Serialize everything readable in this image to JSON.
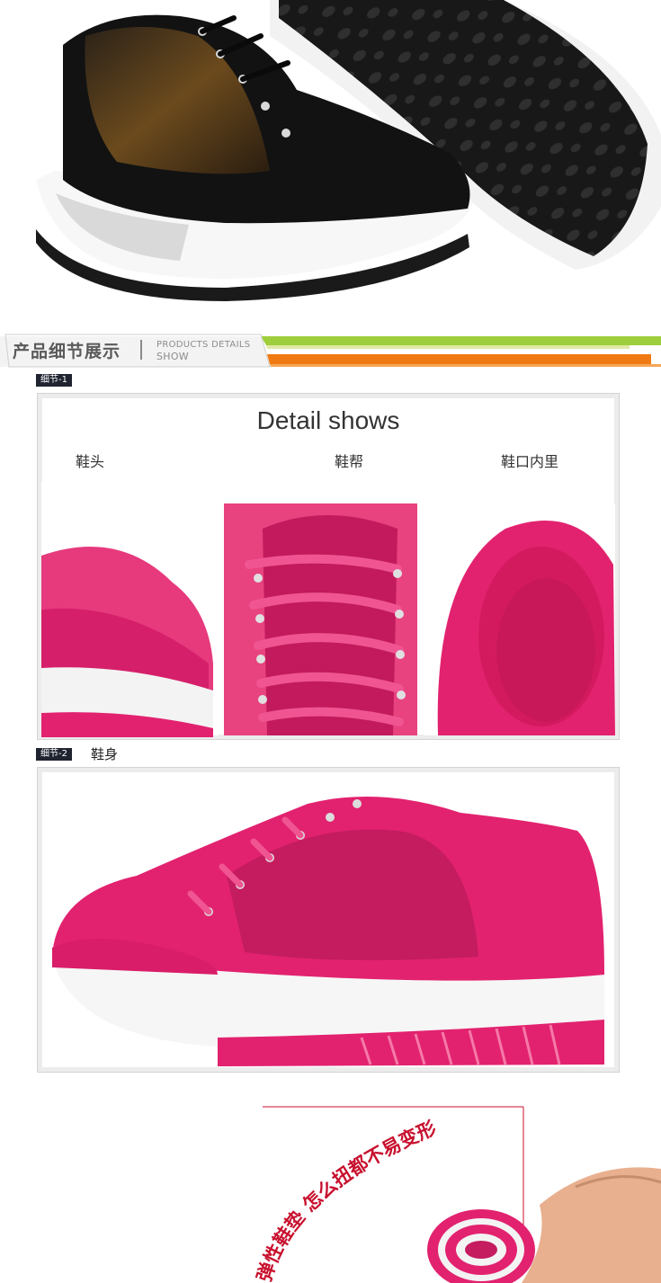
{
  "section_header": {
    "title_cn": "产品细节展示",
    "title_en_line1": "PRODUCTS DETAILS",
    "title_en_line2": "SHOW"
  },
  "detail1": {
    "tag": "细节-1",
    "title": "Detail shows",
    "labels": [
      "鞋头",
      "鞋帮",
      "鞋口内里"
    ]
  },
  "detail2": {
    "tag": "细节-2",
    "label": "鞋身"
  },
  "bottom": {
    "curved_text": "弹性鞋垫 怎么扭都不易变形"
  },
  "colors": {
    "accent_pink": "#e2226f",
    "accent_orange": "#f07a12",
    "accent_green": "#9fce3c",
    "accent_red": "#c8102e"
  }
}
